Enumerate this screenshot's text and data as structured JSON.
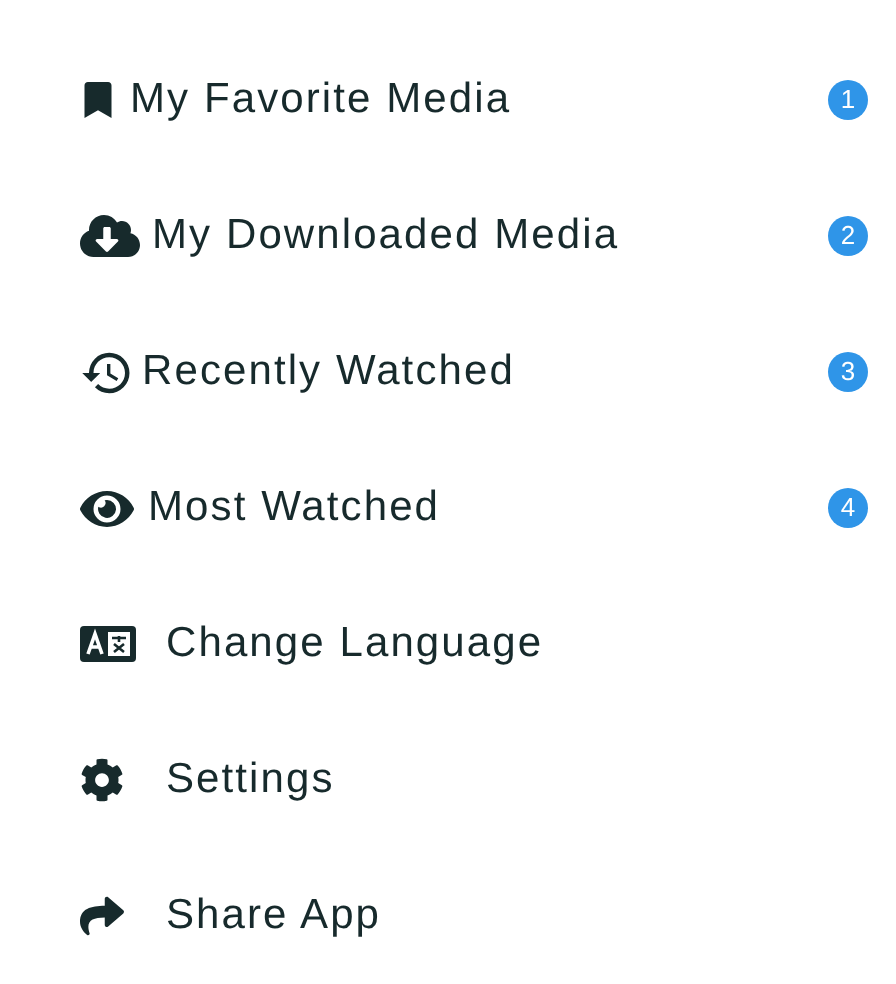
{
  "menu": {
    "items": [
      {
        "label": "My Favorite Media",
        "badge": "1"
      },
      {
        "label": "My Downloaded Media",
        "badge": "2"
      },
      {
        "label": "Recently Watched",
        "badge": "3"
      },
      {
        "label": "Most Watched",
        "badge": "4"
      },
      {
        "label": "Change Language"
      },
      {
        "label": "Settings"
      },
      {
        "label": "Share App"
      }
    ]
  }
}
